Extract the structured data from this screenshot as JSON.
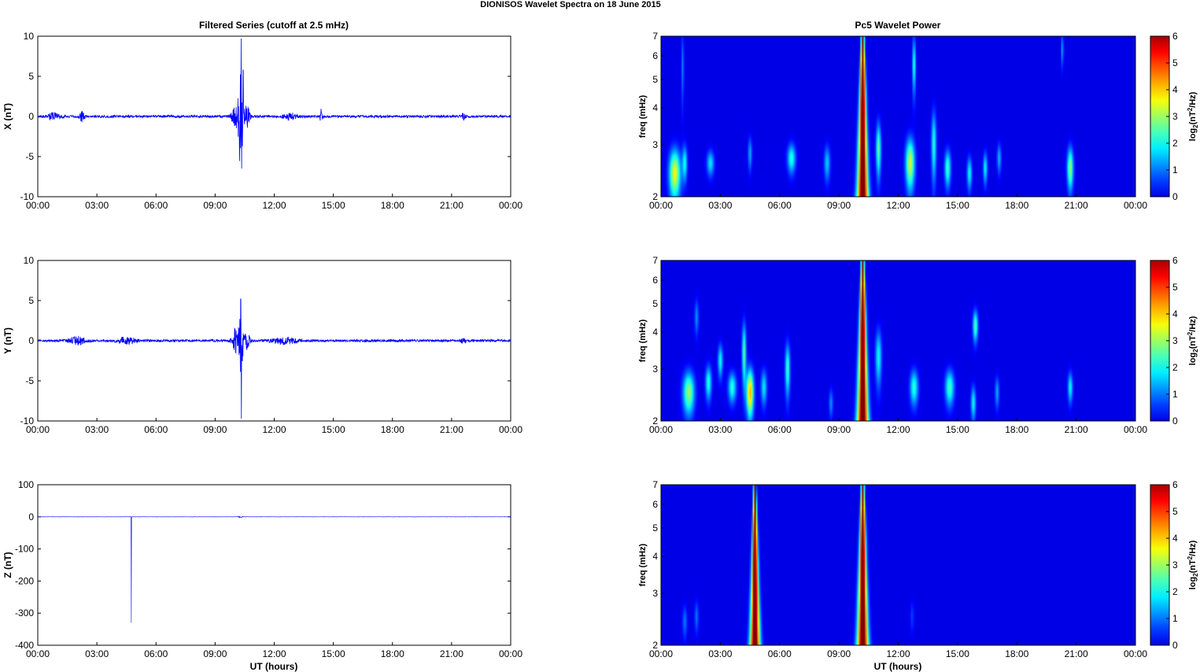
{
  "figure": {
    "title": "DIONISOS Wavelet Spectra on 18 June      2015",
    "left_title": "Filtered Series (cutoff at 2.5 mHz)",
    "right_title": "Pc5 Wavelet Power",
    "xlabel": "UT (hours)",
    "x_ticks": [
      "00:00",
      "03:00",
      "06:00",
      "09:00",
      "12:00",
      "15:00",
      "18:00",
      "21:00",
      "00:00"
    ],
    "freq_label": "freq (mHz)",
    "colorbar_label": "log2(nT2/Hz)",
    "colorbar_ticks": [
      "0",
      "1",
      "2",
      "3",
      "4",
      "5",
      "6"
    ],
    "freq_ticks": [
      "2",
      "3",
      "4",
      "5",
      "6",
      "7"
    ],
    "line_color": "#0000ff"
  },
  "chart_data": [
    {
      "type": "line",
      "ylabel": "X (nT)",
      "ylim": [
        -10,
        10
      ],
      "y_ticks": [
        -10,
        -5,
        0,
        5,
        10
      ],
      "xlim_hours": [
        0,
        24
      ],
      "noise": 0.15,
      "bursts": [
        {
          "t": 0.8,
          "amp": 0.4,
          "w": 0.3
        },
        {
          "t": 2.2,
          "amp": 0.6,
          "w": 0.15
        },
        {
          "t": 10.0,
          "amp": 1.5,
          "w": 0.15
        },
        {
          "t": 10.3,
          "amp": 8.0,
          "w": 0.12
        },
        {
          "t": 10.6,
          "amp": 1.5,
          "w": 0.15
        },
        {
          "t": 12.8,
          "amp": 0.4,
          "w": 0.3
        },
        {
          "t": 14.4,
          "amp": 0.9,
          "w": 0.08
        },
        {
          "t": 21.6,
          "amp": 0.4,
          "w": 0.1
        }
      ],
      "spikes": [
        {
          "t": 10.32,
          "y": 9.7
        },
        {
          "t": 10.35,
          "y": -6.5
        },
        {
          "t": 10.42,
          "y": 5.8
        },
        {
          "t": 10.25,
          "y": -3.5
        }
      ]
    },
    {
      "type": "line",
      "ylabel": "Y (nT)",
      "ylim": [
        -10,
        10
      ],
      "y_ticks": [
        -10,
        -5,
        0,
        5,
        10
      ],
      "xlim_hours": [
        0,
        24
      ],
      "noise": 0.15,
      "bursts": [
        {
          "t": 2.0,
          "amp": 0.5,
          "w": 0.4
        },
        {
          "t": 4.5,
          "amp": 0.4,
          "w": 0.5
        },
        {
          "t": 10.0,
          "amp": 1.5,
          "w": 0.15
        },
        {
          "t": 10.3,
          "amp": 4.5,
          "w": 0.12
        },
        {
          "t": 10.6,
          "amp": 1.2,
          "w": 0.15
        },
        {
          "t": 12.5,
          "amp": 0.4,
          "w": 0.6
        },
        {
          "t": 21.6,
          "amp": 0.3,
          "w": 0.1
        }
      ],
      "spikes": [
        {
          "t": 10.3,
          "y": 5.2
        },
        {
          "t": 10.33,
          "y": -9.7
        },
        {
          "t": 10.38,
          "y": -2.5
        }
      ]
    },
    {
      "type": "line",
      "ylabel": "Z (nT)",
      "ylim": [
        -400,
        100
      ],
      "y_ticks": [
        -400,
        -300,
        -200,
        -100,
        0,
        100
      ],
      "xlim_hours": [
        0,
        24
      ],
      "noise": 0.4,
      "bursts": [
        {
          "t": 10.3,
          "amp": 3.0,
          "w": 0.1
        }
      ],
      "spikes": [
        {
          "t": 4.75,
          "y": -330
        }
      ]
    },
    {
      "type": "heatmap",
      "ylabel": "freq (mHz)",
      "ylim_mhz": [
        2,
        7
      ],
      "log_freq": true,
      "clim": [
        0,
        6
      ],
      "colormap": "jet",
      "xlim_hours": [
        0,
        24
      ],
      "blobs": [
        {
          "t": 0.7,
          "f": 2.4,
          "p": 3.6,
          "tw": 0.28,
          "fw": 0.45
        },
        {
          "t": 1.2,
          "f": 2.6,
          "p": 2.0,
          "tw": 0.12,
          "fw": 0.35
        },
        {
          "t": 2.5,
          "f": 2.6,
          "p": 1.8,
          "tw": 0.18,
          "fw": 0.25
        },
        {
          "t": 1.1,
          "f": 5.5,
          "p": 1.2,
          "tw": 0.06,
          "fw": 1.5
        },
        {
          "t": 4.5,
          "f": 2.8,
          "p": 1.4,
          "tw": 0.1,
          "fw": 0.35
        },
        {
          "t": 6.6,
          "f": 2.7,
          "p": 2.2,
          "tw": 0.2,
          "fw": 0.3
        },
        {
          "t": 8.4,
          "f": 2.6,
          "p": 1.6,
          "tw": 0.15,
          "fw": 0.35
        },
        {
          "t": 11.0,
          "f": 2.9,
          "p": 2.6,
          "tw": 0.12,
          "fw": 0.6
        },
        {
          "t": 12.6,
          "f": 2.6,
          "p": 3.4,
          "tw": 0.22,
          "fw": 0.5
        },
        {
          "t": 12.8,
          "f": 5.6,
          "p": 2.3,
          "tw": 0.08,
          "fw": 1.2
        },
        {
          "t": 13.8,
          "f": 3.0,
          "p": 2.2,
          "tw": 0.12,
          "fw": 0.8
        },
        {
          "t": 14.5,
          "f": 2.5,
          "p": 2.4,
          "tw": 0.15,
          "fw": 0.35
        },
        {
          "t": 15.6,
          "f": 2.4,
          "p": 2.0,
          "tw": 0.12,
          "fw": 0.3
        },
        {
          "t": 16.4,
          "f": 2.5,
          "p": 2.0,
          "tw": 0.1,
          "fw": 0.3
        },
        {
          "t": 17.1,
          "f": 2.7,
          "p": 1.5,
          "tw": 0.1,
          "fw": 0.3
        },
        {
          "t": 20.7,
          "f": 2.5,
          "p": 3.0,
          "tw": 0.15,
          "fw": 0.4
        },
        {
          "t": 20.3,
          "f": 6.3,
          "p": 1.4,
          "tw": 0.06,
          "fw": 0.8
        }
      ],
      "ridges": [
        {
          "t": 10.2,
          "p": 7.0,
          "tw_low": 0.42,
          "tw_high": 0.1
        }
      ]
    },
    {
      "type": "heatmap",
      "ylabel": "freq (mHz)",
      "ylim_mhz": [
        2,
        7
      ],
      "log_freq": true,
      "clim": [
        0,
        6
      ],
      "colormap": "jet",
      "xlim_hours": [
        0,
        24
      ],
      "blobs": [
        {
          "t": 1.4,
          "f": 2.5,
          "p": 3.0,
          "tw": 0.28,
          "fw": 0.4
        },
        {
          "t": 2.4,
          "f": 2.7,
          "p": 2.2,
          "tw": 0.15,
          "fw": 0.35
        },
        {
          "t": 1.8,
          "f": 4.5,
          "p": 1.2,
          "tw": 0.1,
          "fw": 0.6
        },
        {
          "t": 3.0,
          "f": 3.2,
          "p": 2.0,
          "tw": 0.12,
          "fw": 0.4
        },
        {
          "t": 3.6,
          "f": 2.6,
          "p": 2.2,
          "tw": 0.2,
          "fw": 0.3
        },
        {
          "t": 4.5,
          "f": 2.5,
          "p": 4.2,
          "tw": 0.18,
          "fw": 0.45
        },
        {
          "t": 4.2,
          "f": 3.4,
          "p": 2.6,
          "tw": 0.1,
          "fw": 0.8
        },
        {
          "t": 5.2,
          "f": 2.6,
          "p": 1.8,
          "tw": 0.15,
          "fw": 0.35
        },
        {
          "t": 6.4,
          "f": 3.0,
          "p": 2.4,
          "tw": 0.12,
          "fw": 0.6
        },
        {
          "t": 8.6,
          "f": 2.3,
          "p": 1.2,
          "tw": 0.1,
          "fw": 0.25
        },
        {
          "t": 11.0,
          "f": 3.3,
          "p": 2.0,
          "tw": 0.15,
          "fw": 0.7
        },
        {
          "t": 12.8,
          "f": 2.6,
          "p": 2.2,
          "tw": 0.2,
          "fw": 0.35
        },
        {
          "t": 14.6,
          "f": 2.6,
          "p": 2.4,
          "tw": 0.22,
          "fw": 0.35
        },
        {
          "t": 15.8,
          "f": 2.3,
          "p": 2.0,
          "tw": 0.12,
          "fw": 0.3
        },
        {
          "t": 15.9,
          "f": 4.2,
          "p": 2.6,
          "tw": 0.12,
          "fw": 0.5
        },
        {
          "t": 17.0,
          "f": 2.5,
          "p": 1.4,
          "tw": 0.1,
          "fw": 0.3
        },
        {
          "t": 20.7,
          "f": 2.6,
          "p": 2.0,
          "tw": 0.12,
          "fw": 0.3
        }
      ],
      "ridges": [
        {
          "t": 10.2,
          "p": 7.0,
          "tw_low": 0.42,
          "tw_high": 0.1
        }
      ]
    },
    {
      "type": "heatmap",
      "ylabel": "freq (mHz)",
      "ylim_mhz": [
        2,
        7
      ],
      "log_freq": true,
      "clim": [
        0,
        6
      ],
      "colormap": "jet",
      "xlim_hours": [
        0,
        24
      ],
      "blobs": [
        {
          "t": 1.2,
          "f": 2.4,
          "p": 1.0,
          "tw": 0.12,
          "fw": 0.3
        },
        {
          "t": 1.8,
          "f": 2.5,
          "p": 1.0,
          "tw": 0.1,
          "fw": 0.3
        },
        {
          "t": 12.7,
          "f": 2.5,
          "p": 0.6,
          "tw": 0.1,
          "fw": 0.3
        }
      ],
      "ridges": [
        {
          "t": 4.75,
          "p": 7.0,
          "tw_low": 0.38,
          "tw_high": 0.08
        },
        {
          "t": 10.2,
          "p": 7.0,
          "tw_low": 0.42,
          "tw_high": 0.1
        }
      ]
    }
  ]
}
